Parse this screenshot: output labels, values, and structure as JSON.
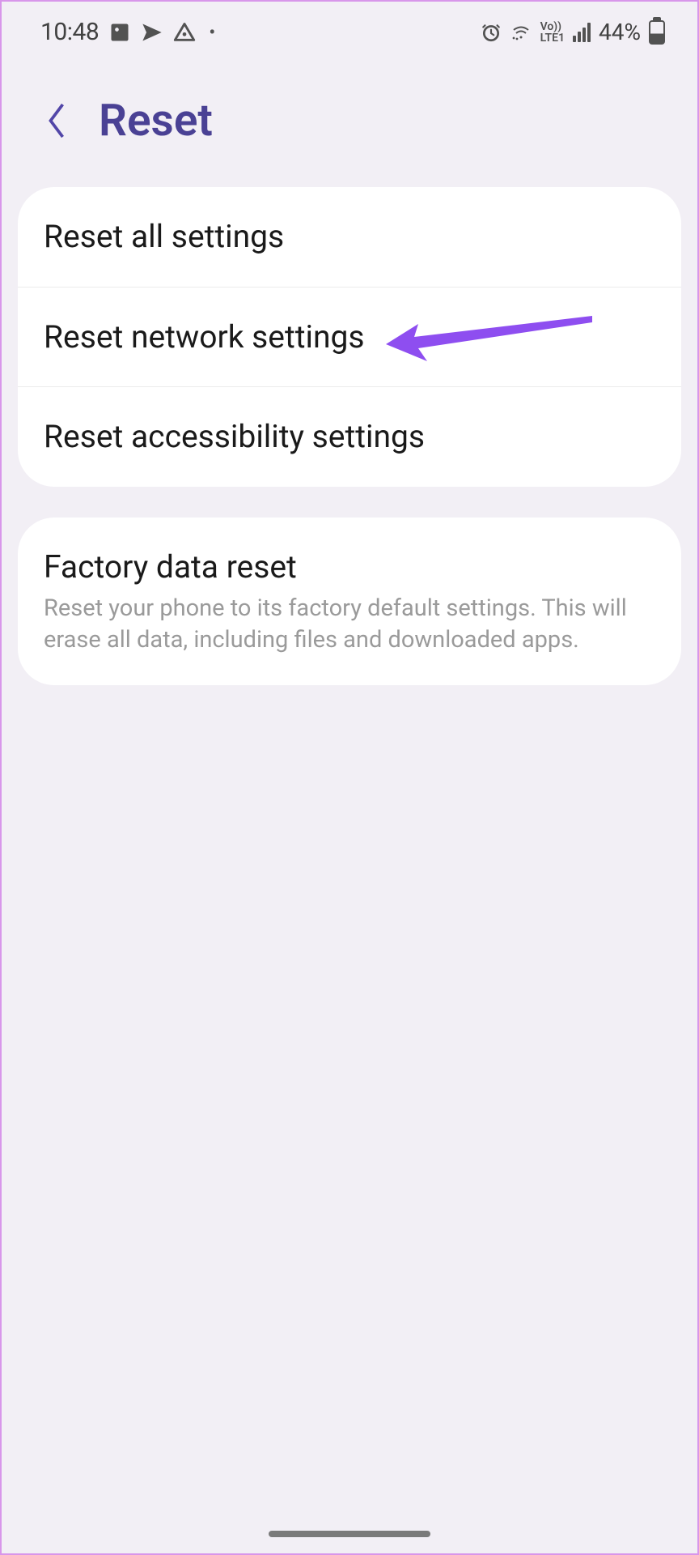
{
  "status_bar": {
    "time": "10:48",
    "battery_percent": "44%",
    "network_label_top": "Vo))",
    "network_label_bottom": "LTE1"
  },
  "header": {
    "title": "Reset"
  },
  "reset_group": {
    "items": [
      {
        "label": "Reset all settings"
      },
      {
        "label": "Reset network settings"
      },
      {
        "label": "Reset accessibility settings"
      }
    ]
  },
  "factory_group": {
    "title": "Factory data reset",
    "subtitle": "Reset your phone to its factory default settings. This will erase all data, including files and downloaded apps."
  }
}
